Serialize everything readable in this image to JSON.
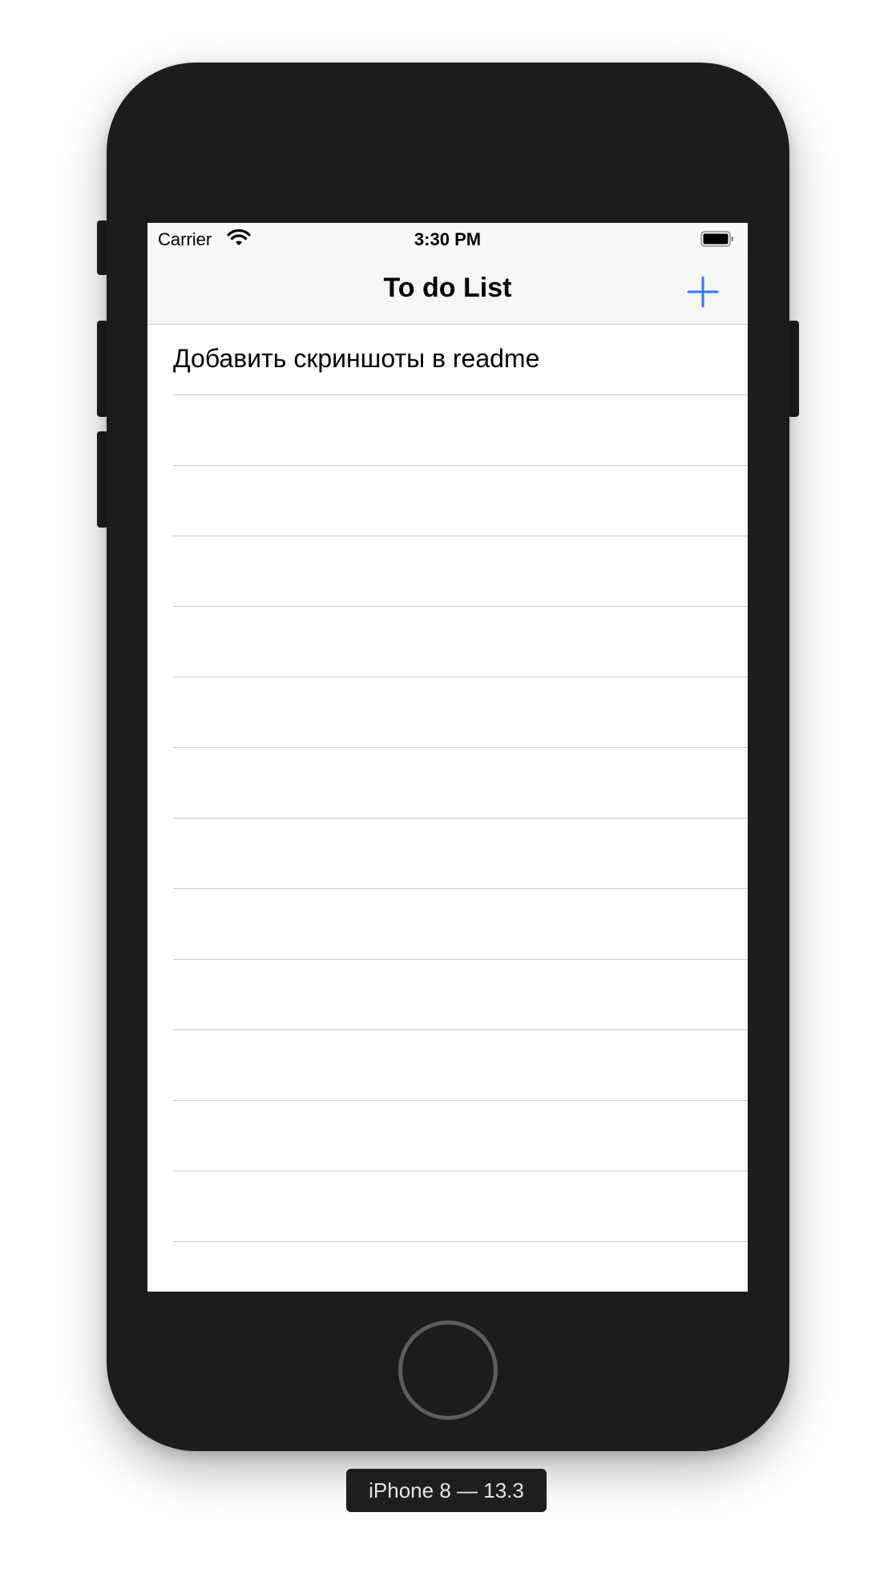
{
  "status_bar": {
    "carrier": "Carrier",
    "time": "3:30 PM",
    "wifi_icon": "wifi-icon",
    "battery_icon": "battery-icon"
  },
  "nav": {
    "title": "To do List",
    "add_icon": "plus-icon",
    "accent_color": "#3478f6"
  },
  "tasks": [
    "Добавить скриншоты в readme",
    "",
    "",
    "",
    "",
    "",
    "",
    "",
    "",
    "",
    "",
    "",
    ""
  ],
  "device_label": "iPhone 8 — 13.3"
}
